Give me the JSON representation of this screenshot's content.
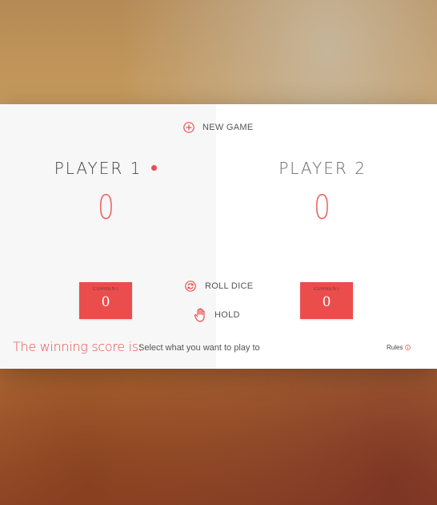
{
  "controls": {
    "new_game": "NEW GAME",
    "roll_dice": "ROLL DICE",
    "hold": "HOLD"
  },
  "players": [
    {
      "name": "PLAYER 1",
      "score": "0",
      "current_label": "CURRENT",
      "current_score": "0",
      "active": true
    },
    {
      "name": "PLAYER 2",
      "score": "0",
      "current_label": "CURRENT",
      "current_score": "0",
      "active": false
    }
  ],
  "winning_score": {
    "label": "The winning score is:",
    "placeholder": "Select what you want to play to",
    "value": ""
  },
  "rules": {
    "label": "Rules"
  },
  "icons": {
    "new_game": "plus-circle-icon",
    "roll_dice": "refresh-circle-icon",
    "hold": "hand-icon",
    "active": "active-dot-icon",
    "rules": "info-icon"
  },
  "colors": {
    "accent": "#eb4d4d",
    "panel_active": "#f7f7f7",
    "panel_inactive": "#ffffff"
  }
}
